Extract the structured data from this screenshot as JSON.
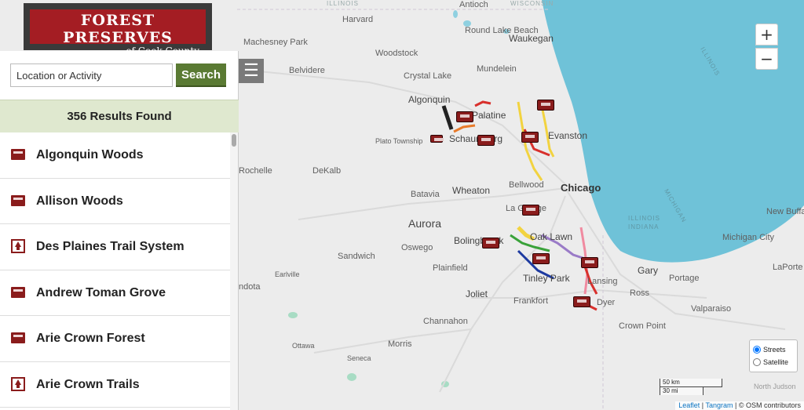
{
  "logo": {
    "line1": "FOREST PRESERVES",
    "line2": "of Cook County"
  },
  "search": {
    "placeholder": "Location or Activity",
    "button_label": "Search"
  },
  "results": {
    "summary": "356 Results Found",
    "items": [
      {
        "label": "Algonquin Woods",
        "icon": "shelter-icon"
      },
      {
        "label": "Allison Woods",
        "icon": "shelter-icon"
      },
      {
        "label": "Des Plaines Trail System",
        "icon": "trail-icon"
      },
      {
        "label": "Andrew Toman Grove",
        "icon": "shelter-icon"
      },
      {
        "label": "Arie Crown Forest",
        "icon": "shelter-icon"
      },
      {
        "label": "Arie Crown Trails",
        "icon": "trail-icon"
      }
    ]
  },
  "menu_toggle": {
    "icon": "hamburger-icon",
    "glyph": "☰"
  },
  "map": {
    "zoom_in": "+",
    "zoom_out": "−",
    "places": {
      "antioch": "Antioch",
      "harvard": "Harvard",
      "illinois_top": "ILLINOIS",
      "wisconsin": "WISCONSIN",
      "round_lake_beach": "Round Lake Beach",
      "machesney_park": "Machesney Park",
      "waukegan": "Waukegan",
      "woodstock": "Woodstock",
      "belvidere": "Belvidere",
      "mundelein": "Mundelein",
      "crystal_lake": "Crystal Lake",
      "algonquin": "Algonquin",
      "palatine": "Palatine",
      "schaumburg": "Schaumburg",
      "plato_township": "Plato Township",
      "evanston": "Evanston",
      "rochelle": "Rochelle",
      "dekalb": "DeKalb",
      "wheaton": "Wheaton",
      "bellwood": "Bellwood",
      "chicago": "Chicago",
      "batavia": "Batavia",
      "la_grange": "La Grange",
      "aurora": "Aurora",
      "oswego": "Oswego",
      "bolingbrook": "Bolingbrook",
      "oak_lawn": "Oak Lawn",
      "sandwich": "Sandwich",
      "plainfield": "Plainfield",
      "earlville": "Earlville",
      "tinley_park": "Tinley Park",
      "lansing": "Lansing",
      "gary": "Gary",
      "portage": "Portage",
      "laporte": "LaPorte",
      "new_buffalo": "New Buffalo",
      "michigan_city": "Michigan City",
      "mendota": "ndota",
      "joliet": "Joliet",
      "frankfort": "Frankfort",
      "dyer": "Dyer",
      "ross": "Ross",
      "valparaiso": "Valparaiso",
      "channahon": "Channahon",
      "crown_point": "Crown Point",
      "morris": "Morris",
      "ottawa": "Ottawa",
      "seneca": "Seneca",
      "north_judson": "North Judson",
      "illinois_lake": "ILLINOIS",
      "indiana_lake": "INDIANA",
      "michigan_lake": "MICHIGAN"
    },
    "layers": {
      "streets": "Streets",
      "satellite": "Satellite",
      "selected": "Streets"
    },
    "scale": {
      "metric": "50 km",
      "imperial": "30 mi"
    },
    "attribution": {
      "leaflet": "Leaflet",
      "sep1": " | ",
      "tangram": "Tangram",
      "rest": " | © OSM contributors"
    },
    "colors": {
      "lake": "#6fc2d8",
      "land": "#ececec",
      "marker": "#8a1c1c",
      "search_button": "#5a7a33",
      "results_bar": "#dfe8cf"
    }
  }
}
